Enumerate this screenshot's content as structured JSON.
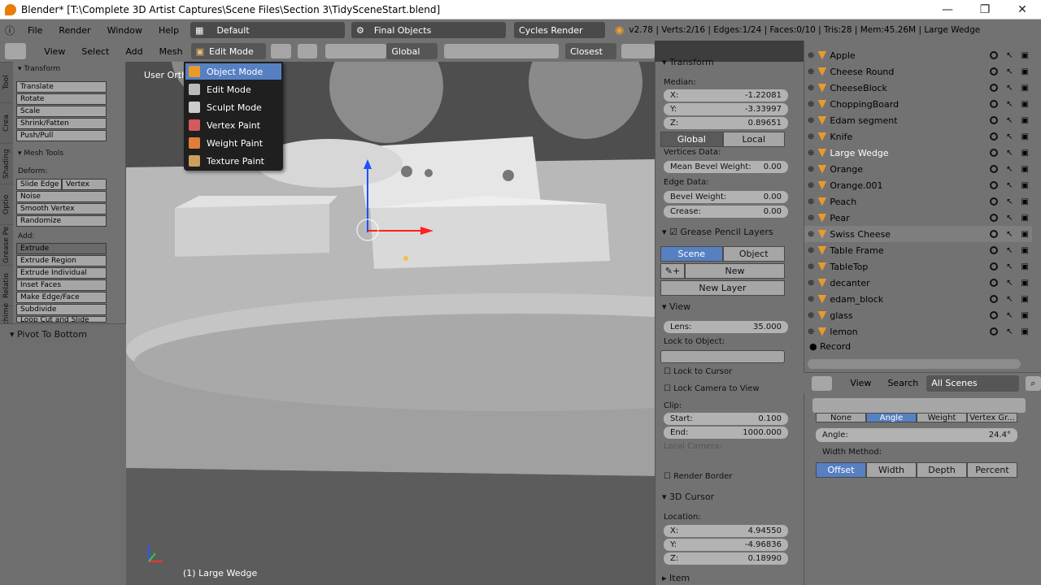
{
  "window": {
    "title": "Blender* [T:\\Complete 3D Artist Captures\\Scene Files\\Section 3\\TidySceneStart.blend]"
  },
  "info_bar": {
    "menus": [
      "File",
      "Render",
      "Window",
      "Help"
    ],
    "screen_layout": "Default",
    "scene": "Final Objects",
    "engine": "Cycles Render",
    "stats": "v2.78 | Verts:2/16 | Edges:1/24 | Faces:0/10 | Tris:28 | Mem:45.26M | Large Wedge"
  },
  "header": {
    "menus": [
      "View",
      "Select",
      "Add",
      "Mesh"
    ],
    "mode": "Edit Mode",
    "orientation": "Global",
    "snap": "Closest"
  },
  "mode_menu": {
    "items": [
      "Object Mode",
      "Edit Mode",
      "Sculpt Mode",
      "Vertex Paint",
      "Weight Paint",
      "Texture Paint"
    ]
  },
  "viewport": {
    "view_label": "User Orth",
    "footer": "(1) Large Wedge"
  },
  "tool_shelf": {
    "tabs": [
      "Tool",
      "Crea",
      "Shading",
      "Optio",
      "Grease Pe",
      "Relatio",
      "Archime"
    ],
    "transform_title": "Transform",
    "transform_buttons": [
      "Translate",
      "Rotate",
      "Scale",
      "Shrink/Fatten",
      "Push/Pull"
    ],
    "mesh_tools_title": "Mesh Tools",
    "deform_label": "Deform:",
    "deform_buttons": [
      "Slide Edge",
      "Vertex",
      "Noise",
      "Smooth Vertex",
      "Randomize"
    ],
    "add_label": "Add:",
    "add_buttons": [
      "Extrude",
      "Extrude Region",
      "Extrude Individual",
      "Inset Faces",
      "Make Edge/Face",
      "Subdivide",
      "Loop Cut and Slide"
    ],
    "operator_title": "Pivot To Bottom"
  },
  "properties": {
    "transform_title": "Transform",
    "median_label": "Median:",
    "median": [
      {
        "k": "X:",
        "v": "-1.22081"
      },
      {
        "k": "Y:",
        "v": "-3.33997"
      },
      {
        "k": "Z:",
        "v": "0.89651"
      }
    ],
    "space_buttons": [
      "Global",
      "Local"
    ],
    "vertices_label": "Vertices Data:",
    "mean_bevel": {
      "k": "Mean Bevel Weight:",
      "v": "0.00"
    },
    "edge_label": "Edge Data:",
    "bevel_weight": {
      "k": "Bevel Weight:",
      "v": "0.00"
    },
    "crease": {
      "k": "Crease:",
      "v": "0.00"
    },
    "grease_title": "Grease Pencil Layers",
    "grease_tabs": [
      "Scene",
      "Object"
    ],
    "new_label": "New",
    "new_layer_label": "New Layer",
    "view_title": "View",
    "lens": {
      "k": "Lens:",
      "v": "35.000"
    },
    "lock_object_label": "Lock to Object:",
    "lock_cursor": "Lock to Cursor",
    "lock_camera": "Lock Camera to View",
    "clip_label": "Clip:",
    "clip_start": {
      "k": "Start:",
      "v": "0.100"
    },
    "clip_end": {
      "k": "End:",
      "v": "1000.000"
    },
    "local_camera": "Local Camera:",
    "render_border": "Render Border",
    "cursor_title": "3D Cursor",
    "location_label": "Location:",
    "cursor": [
      {
        "k": "X:",
        "v": "4.94550"
      },
      {
        "k": "Y:",
        "v": "-4.96836"
      },
      {
        "k": "Z:",
        "v": "0.18990"
      }
    ],
    "item_title": "Item"
  },
  "outliner": {
    "items": [
      "Apple",
      "Cheese Round",
      "CheeseBlock",
      "ChoppingBoard",
      "Edam segment",
      "Knife",
      "Large Wedge",
      "Orange",
      "Orange.001",
      "Peach",
      "Pear",
      "Swiss Cheese",
      "Table Frame",
      "TableTop",
      "decanter",
      "edam_block",
      "glass",
      "lemon"
    ],
    "record_label": "Record",
    "header_menus": [
      "View",
      "Search"
    ],
    "filter": "All Scenes"
  },
  "modifier_panel": {
    "tabs": [
      "None",
      "Angle",
      "Weight",
      "Vertex Gr..."
    ],
    "angle": {
      "k": "Angle:",
      "v": "24.4°"
    },
    "width_method_label": "Width Method:",
    "width_methods": [
      "Offset",
      "Width",
      "Depth",
      "Percent"
    ]
  },
  "colors": {
    "accent": "#5680c2",
    "menu_bg": "#1f1f1f",
    "panel": "#727272",
    "viewport": "#5a5a5a"
  }
}
